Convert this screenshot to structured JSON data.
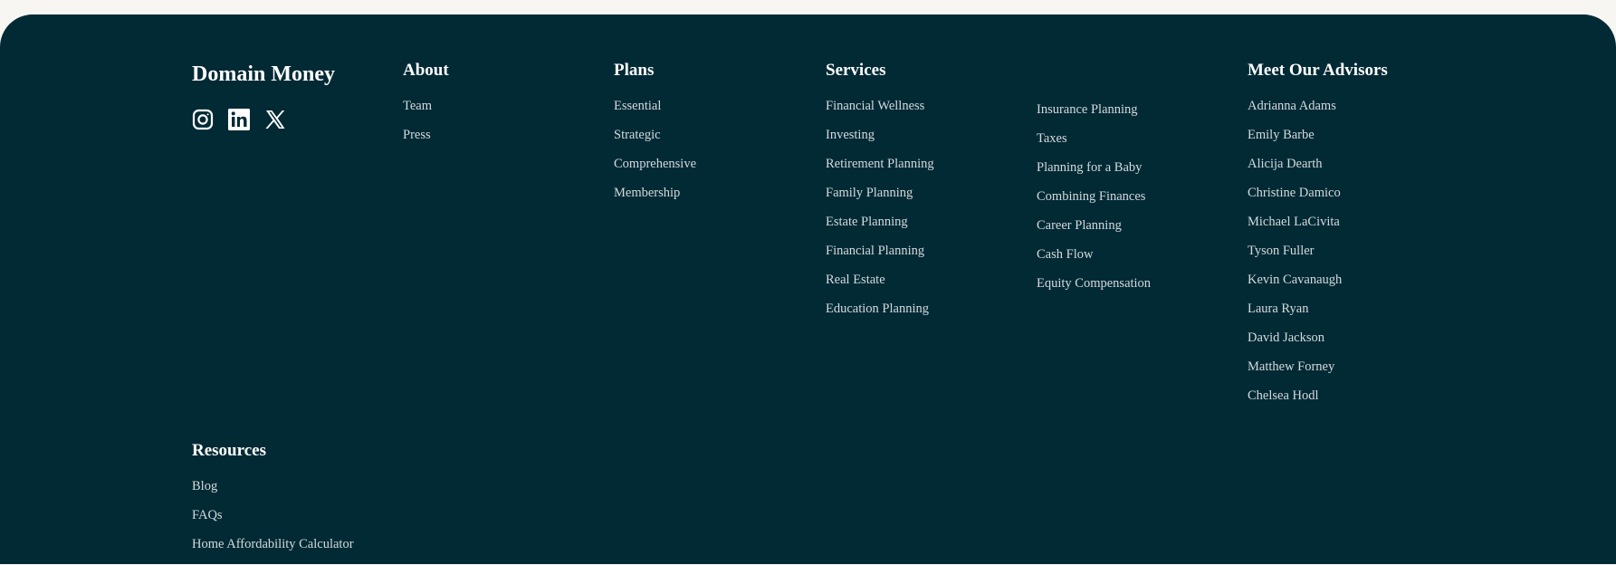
{
  "brand": {
    "name": "Domain Money",
    "social_icons": [
      "instagram-icon",
      "linkedin-icon",
      "x-twitter-icon"
    ]
  },
  "about": {
    "heading": "About",
    "links": [
      "Team",
      "Press"
    ]
  },
  "plans": {
    "heading": "Plans",
    "links": [
      "Essential",
      "Strategic",
      "Comprehensive",
      "Membership"
    ]
  },
  "services": {
    "heading": "Services",
    "links": [
      "Financial Wellness",
      "Investing",
      "Retirement Planning",
      "Family Planning",
      "Estate Planning",
      "Financial Planning",
      "Real Estate",
      "Education Planning"
    ],
    "links_col2": [
      "Insurance Planning",
      "Taxes",
      "Planning for a Baby",
      "Combining Finances",
      "Career Planning",
      "Cash Flow",
      "Equity Compensation"
    ]
  },
  "advisors": {
    "heading": "Meet Our Advisors",
    "links": [
      "Adrianna Adams",
      "Emily Barbe",
      "Alicija Dearth",
      "Christine Damico",
      "Michael LaCivita",
      "Tyson Fuller",
      "Kevin Cavanaugh",
      "Laura Ryan",
      "David Jackson",
      "Matthew Forney",
      "Chelsea Hodl"
    ]
  },
  "resources": {
    "heading": "Resources",
    "links": [
      "Blog",
      "FAQs",
      "Home Affordability Calculator"
    ]
  },
  "colors": {
    "footer_bg": "#022a35",
    "page_bg": "#f8f6f3",
    "heading_text": "#ffffff",
    "link_text": "#d3dadd"
  }
}
